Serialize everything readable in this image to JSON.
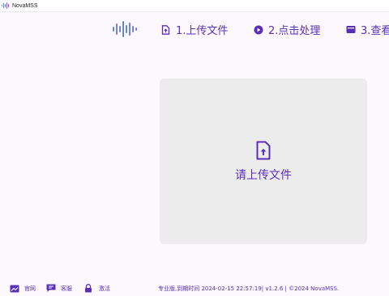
{
  "window": {
    "title": "NovaMSS",
    "icon": "waveform-icon"
  },
  "header": {
    "logo": "waveform-logo-icon",
    "steps": [
      {
        "label": "1.上传文件",
        "icon": "upload-file-icon"
      },
      {
        "label": "2.点击处理",
        "icon": "play-circle-icon"
      },
      {
        "label": "3.查看",
        "icon": "folder-icon"
      }
    ]
  },
  "upload": {
    "label": "请上传文件",
    "icon": "file-upload-icon"
  },
  "footer": {
    "links": [
      {
        "label": "官网",
        "icon": "website-icon"
      },
      {
        "label": "客服",
        "icon": "chat-icon"
      },
      {
        "label": "激活",
        "icon": "lock-icon"
      }
    ],
    "status": "专业版,到期时间 2024-02-15 22:57:19| v1.2.6 | ©2024 NovaMSS."
  },
  "colors": {
    "accent": "#5a2fb8",
    "background": "#fcf8fe",
    "panel": "#ececec"
  }
}
